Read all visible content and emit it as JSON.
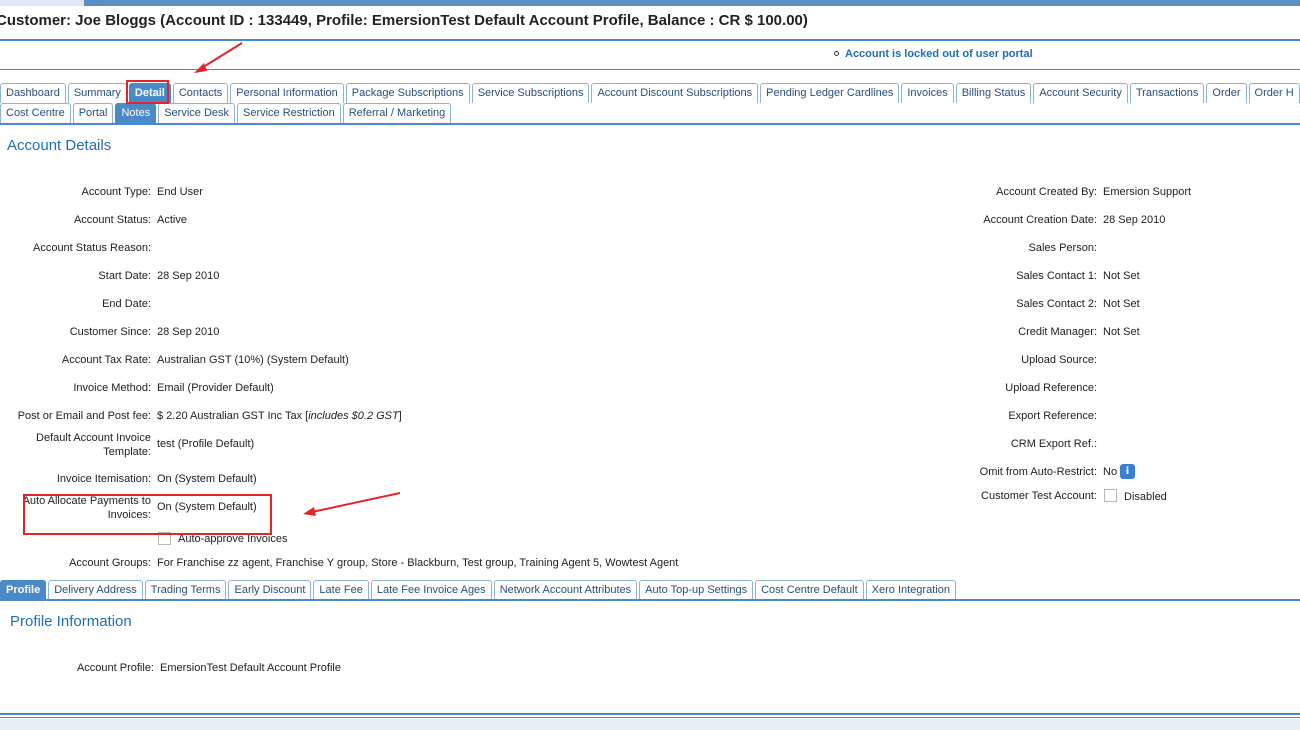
{
  "header": {
    "title": "Customer: Joe Bloggs (Account ID : 133449, Profile: EmersionTest Default Account Profile, Balance : CR $ 100.00)",
    "lock_message": "Account is locked out of user portal"
  },
  "main_tabs_row1": [
    "Dashboard",
    "Summary",
    "Detail",
    "Contacts",
    "Personal Information",
    "Package Subscriptions",
    "Service Subscriptions",
    "Account Discount Subscriptions",
    "Pending Ledger Cardlines",
    "Invoices",
    "Billing Status",
    "Account Security",
    "Transactions",
    "Order",
    "Order H"
  ],
  "main_tabs_row2": [
    "Cost Centre",
    "Portal",
    "Notes",
    "Service Desk",
    "Service Restriction",
    "Referral / Marketing"
  ],
  "active_tabs": {
    "row1": "Detail",
    "row2": "Notes"
  },
  "account_details": {
    "title": "Account Details",
    "left_fields": [
      {
        "label": "Account Type:",
        "value": "End User"
      },
      {
        "label": "Account Status:",
        "value": "Active"
      },
      {
        "label": "Account Status Reason:",
        "value": ""
      },
      {
        "label": "Start Date:",
        "value": "28 Sep 2010"
      },
      {
        "label": "End Date:",
        "value": ""
      },
      {
        "label": "Customer Since:",
        "value": "28 Sep 2010"
      },
      {
        "label": "Account Tax Rate:",
        "value": "Australian GST (10%) (System Default)"
      },
      {
        "label": "Invoice Method:",
        "value": "Email (Provider Default)"
      },
      {
        "label": "Post or Email and Post fee:",
        "value": "$  2.20  Australian GST  Inc Tax [",
        "value_italic": "includes $0.2 GST",
        "value_suffix": "]"
      },
      {
        "label": "Default Account Invoice Template:",
        "value": "test (Profile Default)"
      },
      {
        "label": "Invoice Itemisation:",
        "value": "On (System Default)"
      },
      {
        "label": "Auto Allocate Payments to Invoices:",
        "value": "On (System Default)"
      },
      {
        "label": "",
        "value": "Auto-approve Invoices"
      },
      {
        "label": "Account Groups:",
        "value": "For Franchise zz agent, Franchise Y group, Store - Blackburn, Test group, Training Agent 5, Wowtest Agent"
      }
    ],
    "right_fields": [
      {
        "label": "Account Created By:",
        "value": "Emersion Support"
      },
      {
        "label": "Account Creation Date:",
        "value": "28 Sep 2010"
      },
      {
        "label": "Sales Person:",
        "value": ""
      },
      {
        "label": "Sales Contact 1:",
        "value": "Not Set"
      },
      {
        "label": "Sales Contact 2:",
        "value": "Not Set"
      },
      {
        "label": "Credit Manager:",
        "value": "Not Set"
      },
      {
        "label": "Upload Source:",
        "value": ""
      },
      {
        "label": "Upload Reference:",
        "value": ""
      },
      {
        "label": "Export Reference:",
        "value": ""
      },
      {
        "label": "CRM Export Ref.:",
        "value": ""
      },
      {
        "label": "Omit from Auto-Restrict:",
        "value": "No"
      },
      {
        "label": "Customer Test Account:",
        "value": "Disabled"
      }
    ],
    "info_icon_glyph": "i"
  },
  "sub_tabs": [
    "Profile",
    "Delivery Address",
    "Trading Terms",
    "Early Discount",
    "Late Fee",
    "Late Fee Invoice Ages",
    "Network Account Attributes",
    "Auto Top-up Settings",
    "Cost Centre Default",
    "Xero Integration"
  ],
  "active_sub_tab": "Profile",
  "profile_info": {
    "title": "Profile Information",
    "label": "Account Profile:",
    "value": "EmersionTest Default Account Profile"
  },
  "colors": {
    "accent": "#4a8ac9",
    "link_text": "#1f6fb5",
    "annotation_red": "#e0262a"
  },
  "icons": {
    "info": "info-icon",
    "checkbox": "checkbox-icon",
    "annotation": "arrow-annotation"
  }
}
